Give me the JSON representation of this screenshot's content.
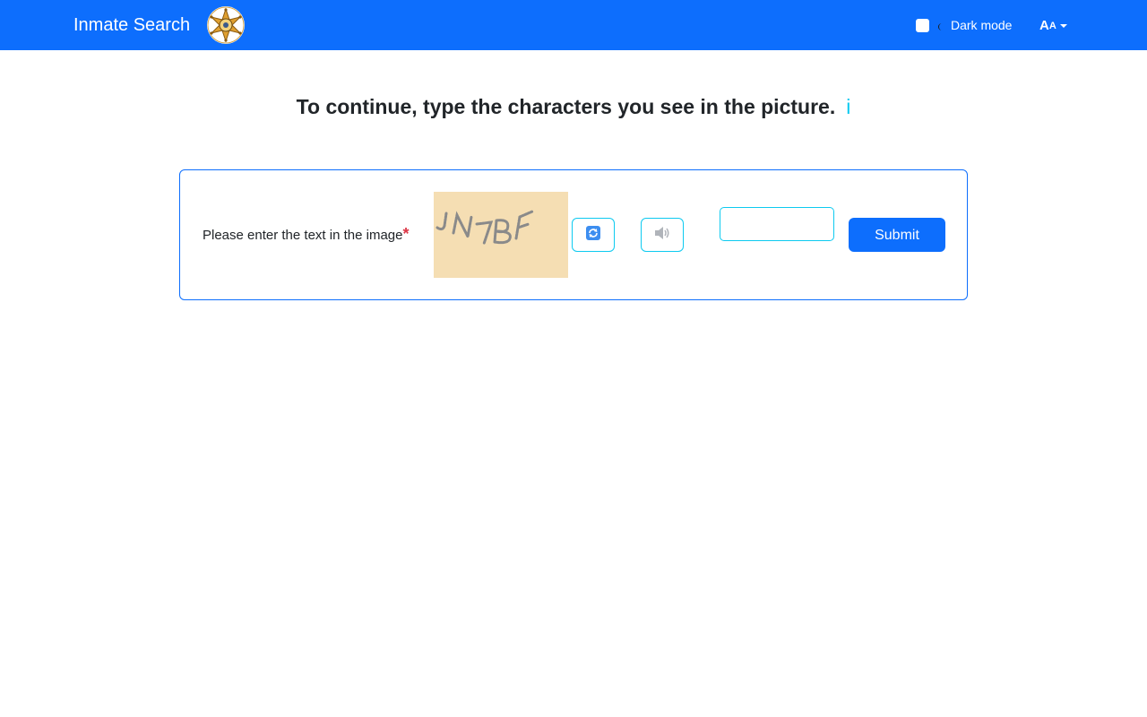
{
  "navbar": {
    "brand": "Inmate Search",
    "logo_icon": "sheriff-star-badge",
    "dark_mode_label": "Dark mode",
    "dark_mode_checked": false,
    "font_size_label_big": "A",
    "font_size_label_small": "A",
    "background_color": "#0d6efd"
  },
  "heading": {
    "text": "To continue, type the characters you see in the picture.",
    "info_link": "i"
  },
  "captcha": {
    "prompt": "Please enter the text in the image",
    "required_mark": "*",
    "image_text": "JN7BF",
    "refresh_icon": "refresh-icon",
    "audio_icon": "speaker-icon",
    "input_value": "",
    "submit_label": "Submit"
  }
}
